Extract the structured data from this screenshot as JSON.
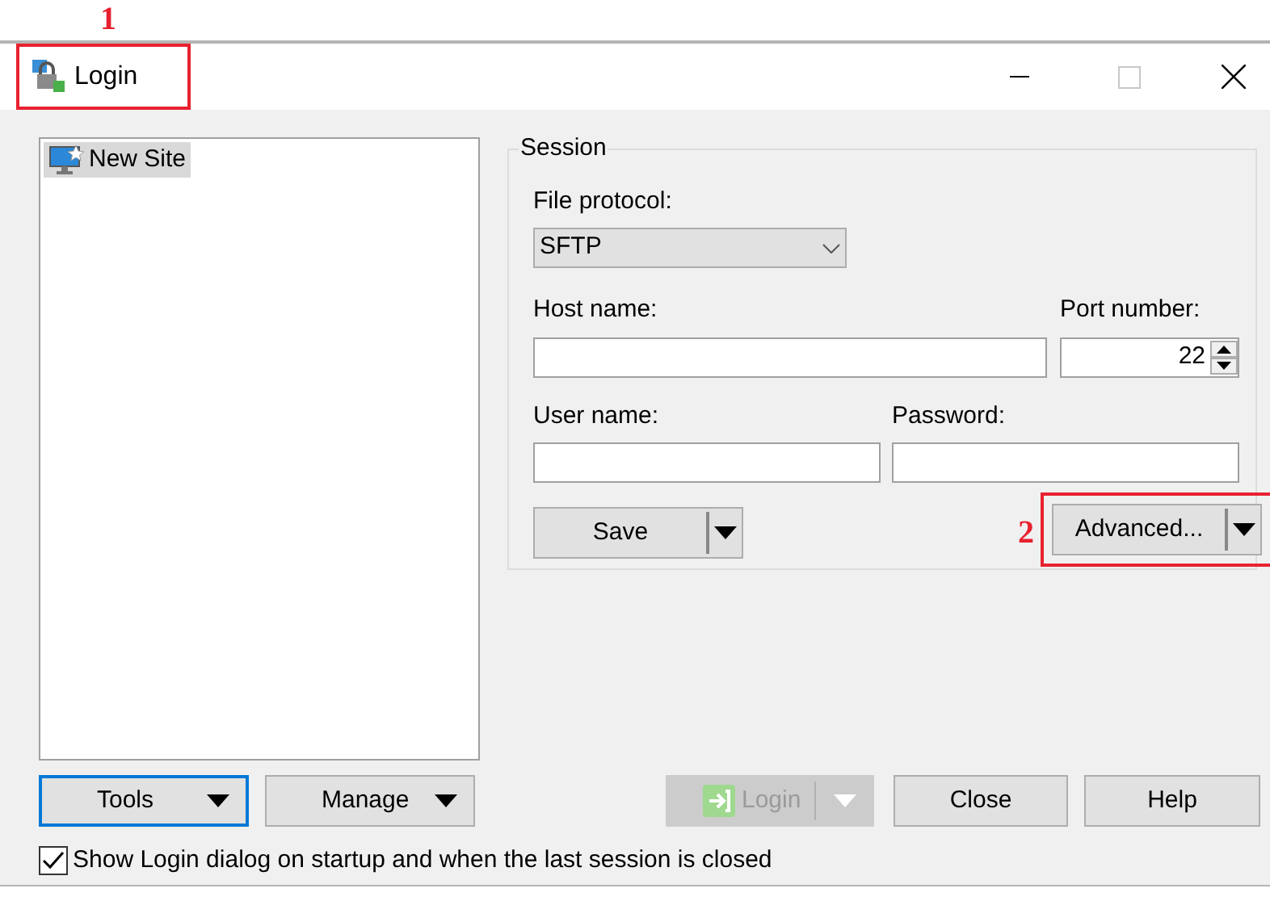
{
  "annotations": [
    {
      "label": "1"
    },
    {
      "label": "2"
    }
  ],
  "window": {
    "title": "Login"
  },
  "sites": [
    {
      "label": "New Site",
      "selected": true
    }
  ],
  "session": {
    "title": "Session",
    "protocol_label": "File protocol:",
    "protocol": "SFTP",
    "host_label": "Host name:",
    "port_label": "Port number:",
    "port": "22",
    "user_label": "User name:",
    "password_label": "Password:",
    "save": "Save",
    "advanced": "Advanced..."
  },
  "buttons": [
    {
      "label": "Tools",
      "kind": "menu",
      "focused": true,
      "disabled": false
    },
    {
      "label": "Manage",
      "kind": "menu",
      "focused": false,
      "disabled": false
    },
    {
      "label": "Login",
      "kind": "split",
      "focused": false,
      "disabled": true
    },
    {
      "label": "Close",
      "kind": "plain",
      "focused": false,
      "disabled": false
    },
    {
      "label": "Help",
      "kind": "plain",
      "focused": false,
      "disabled": false
    }
  ],
  "startup_checkbox": {
    "label": "Show Login dialog on startup and when the last session is closed",
    "checked": true
  }
}
